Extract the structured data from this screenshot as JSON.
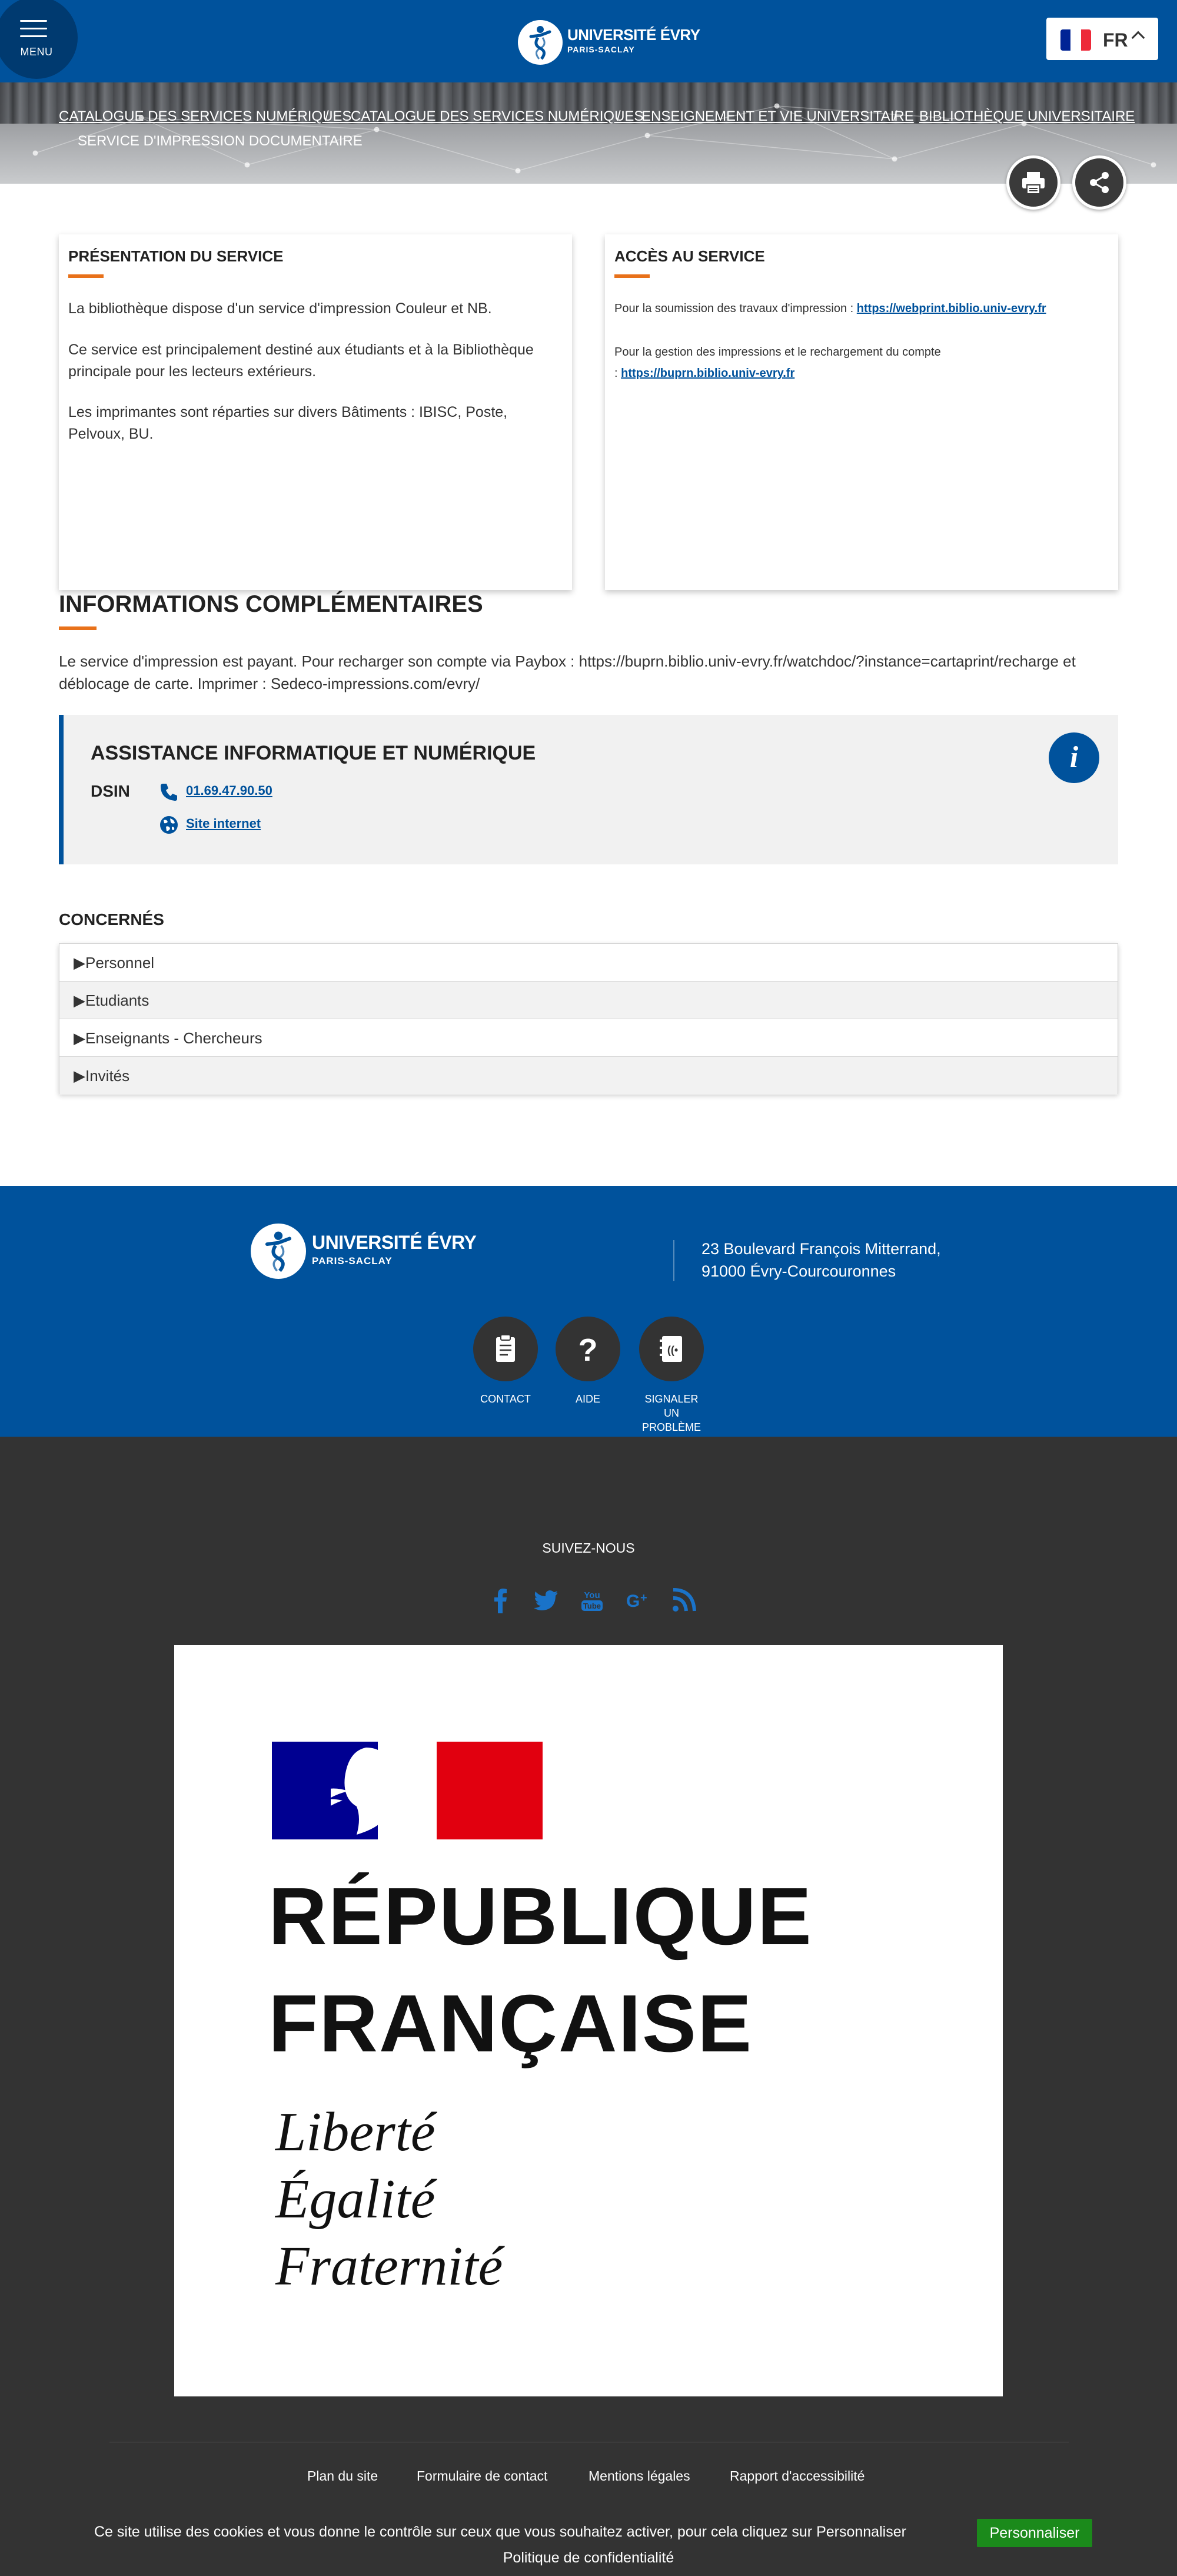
{
  "header": {
    "menu_label": "MENU",
    "logo_line1": "UNIVERSITÉ ÉVRY",
    "logo_line2": "PARIS-SACLAY",
    "lang_code": "FR",
    "brand_color": "#00529c"
  },
  "breadcrumb": {
    "items": [
      "Catalogue des services numériques",
      "Catalogue des services numériques",
      "Enseignement et vie universitaire",
      "Bibliothèque universitaire"
    ],
    "current": "Service d'impression documentaire",
    "separator": "/"
  },
  "actions": {
    "print_icon": "printer-icon",
    "share_icon": "share-icon"
  },
  "presentation": {
    "title": "Présentation du service",
    "paragraphs": [
      "La bibliothèque dispose d'un service d'impression Couleur et NB.",
      "Ce service est principalement destiné aux étudiants et à la Bibliothèque principale pour les lecteurs extérieurs.",
      "Les imprimantes sont réparties sur divers Bâtiments : IBISC, Poste, Pelvoux, BU."
    ]
  },
  "access": {
    "title": "Accès au service",
    "line1_text": "Pour la soumission des travaux d'impression : ",
    "line1_link": "https://webprint.biblio.univ-evry.fr",
    "line2_text": "Pour la gestion des impressions et le rechargement du compte",
    "line2_prefix": ": ",
    "line2_link": "https://buprn.biblio.univ-evry.fr"
  },
  "info": {
    "title": "Informations complémentaires",
    "text": "Le service d'impression est payant. Pour recharger son compte via Paybox :  https://buprn.biblio.univ-evry.fr/watchdoc/?instance=cartaprint/recharge et déblocage de carte.  Imprimer : Sedeco-impressions.com/evry/"
  },
  "assistance": {
    "title": "Assistance informatique et numérique",
    "org": "DSIN",
    "phone": "01.69.47.90.50",
    "site_label": "Site internet",
    "badge": "i"
  },
  "concerned": {
    "title": "Concernés",
    "items": [
      "Personnel",
      "Etudiants",
      "Enseignants - Chercheurs",
      "Invités"
    ],
    "marker": "▶"
  },
  "footer": {
    "logo_line1": "UNIVERSITÉ ÉVRY",
    "logo_line2": "PARIS-SACLAY",
    "address_line1": "23 Boulevard François Mitterrand,",
    "address_line2": "91000 Évry-Courcouronnes",
    "contact_label": "CONTACT",
    "help_label": "AIDE",
    "report_label": "SIGNALER UN PROBLÈME",
    "follow": "Suivez-nous",
    "republic_name_1": "RÉPUBLIQUE",
    "republic_name_2": "FRANÇAISE",
    "motto_1": "Liberté",
    "motto_2": "Égalité",
    "motto_3": "Fraternité",
    "links": [
      "Plan du site",
      "Formulaire de contact",
      "Mentions légales",
      "Rapport d'accessibilité"
    ]
  },
  "cookie": {
    "message": "Ce site utilise des cookies et vous donne le contrôle sur ceux que vous souhaitez activer, pour cela cliquez sur Personnaliser",
    "button": "Personnaliser",
    "policy": "Politique de confidentialité"
  }
}
